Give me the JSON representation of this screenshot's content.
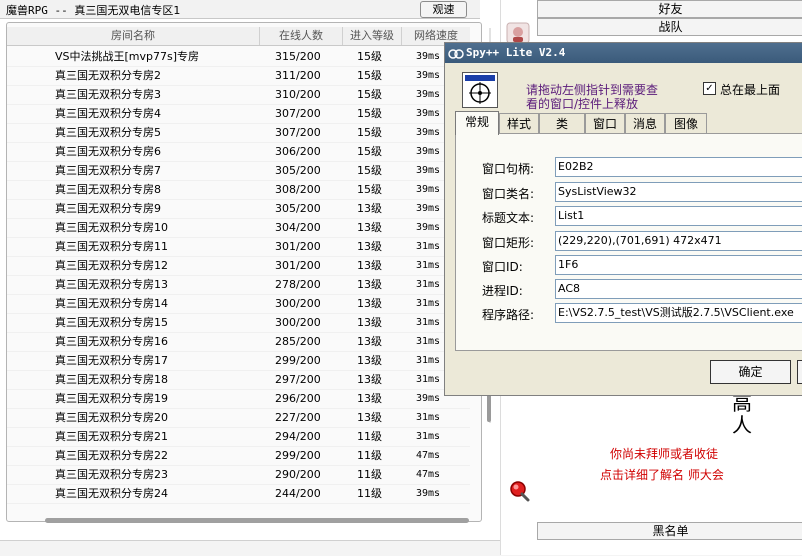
{
  "window": {
    "title_prefix": "魔兽RPG -- ",
    "title_main": "真三国无双电信专区1",
    "watch_button": "观速"
  },
  "room_list": {
    "columns": [
      "房间名称",
      "在线人数",
      "进入等级",
      "网络速度"
    ],
    "rows": [
      {
        "name": "VS中法挑战王[mvp77s]专房",
        "online": "315/200",
        "level": "15级",
        "speed": "39ms"
      },
      {
        "name": "真三国无双积分专房2",
        "online": "311/200",
        "level": "15级",
        "speed": "39ms"
      },
      {
        "name": "真三国无双积分专房3",
        "online": "310/200",
        "level": "15级",
        "speed": "39ms"
      },
      {
        "name": "真三国无双积分专房4",
        "online": "307/200",
        "level": "15级",
        "speed": "39ms"
      },
      {
        "name": "真三国无双积分专房5",
        "online": "307/200",
        "level": "15级",
        "speed": "39ms"
      },
      {
        "name": "真三国无双积分专房6",
        "online": "306/200",
        "level": "15级",
        "speed": "39ms"
      },
      {
        "name": "真三国无双积分专房7",
        "online": "305/200",
        "level": "15级",
        "speed": "39ms"
      },
      {
        "name": "真三国无双积分专房8",
        "online": "308/200",
        "level": "15级",
        "speed": "39ms"
      },
      {
        "name": "真三国无双积分专房9",
        "online": "305/200",
        "level": "13级",
        "speed": "39ms"
      },
      {
        "name": "真三国无双积分专房10",
        "online": "304/200",
        "level": "13级",
        "speed": "39ms"
      },
      {
        "name": "真三国无双积分专房11",
        "online": "301/200",
        "level": "13级",
        "speed": "31ms"
      },
      {
        "name": "真三国无双积分专房12",
        "online": "301/200",
        "level": "13级",
        "speed": "31ms"
      },
      {
        "name": "真三国无双积分专房13",
        "online": "278/200",
        "level": "13级",
        "speed": "31ms"
      },
      {
        "name": "真三国无双积分专房14",
        "online": "300/200",
        "level": "13级",
        "speed": "31ms"
      },
      {
        "name": "真三国无双积分专房15",
        "online": "300/200",
        "level": "13级",
        "speed": "31ms"
      },
      {
        "name": "真三国无双积分专房16",
        "online": "285/200",
        "level": "13级",
        "speed": "31ms"
      },
      {
        "name": "真三国无双积分专房17",
        "online": "299/200",
        "level": "13级",
        "speed": "31ms"
      },
      {
        "name": "真三国无双积分专房18",
        "online": "297/200",
        "level": "13级",
        "speed": "31ms"
      },
      {
        "name": "真三国无双积分专房19",
        "online": "296/200",
        "level": "13级",
        "speed": "39ms"
      },
      {
        "name": "真三国无双积分专房20",
        "online": "227/200",
        "level": "13级",
        "speed": "31ms"
      },
      {
        "name": "真三国无双积分专房21",
        "online": "294/200",
        "level": "11级",
        "speed": "31ms"
      },
      {
        "name": "真三国无双积分专房22",
        "online": "299/200",
        "level": "11级",
        "speed": "47ms"
      },
      {
        "name": "真三国无双积分专房23",
        "online": "290/200",
        "level": "11级",
        "speed": "47ms"
      },
      {
        "name": "真三国无双积分专房24",
        "online": "244/200",
        "level": "11级",
        "speed": "39ms"
      }
    ]
  },
  "right_panel": {
    "buttons": [
      "好友",
      "战队"
    ],
    "blacklist_button": "黑名单",
    "calligraphy": "高人",
    "master_text_1": "你尚未拜师或者收徒",
    "master_text_2": "点击详细了解名 师大会"
  },
  "spy": {
    "title": "Spy++ Lite V2.4",
    "hint_line1": "请拖动左侧指针到需要查",
    "hint_line2": "看的窗口/控件上释放",
    "topmost_label": "总在最上面",
    "topmost_checked": "✓",
    "tabs": [
      "常规",
      "样式",
      "类",
      "窗口",
      "消息",
      "图像"
    ],
    "fields": [
      {
        "label": "窗口句柄:",
        "value": "E02B2"
      },
      {
        "label": "窗口类名:",
        "value": "SysListView32"
      },
      {
        "label": "标题文本:",
        "value": "List1"
      },
      {
        "label": "窗口矩形:",
        "value": "(229,220),(701,691)  472x471"
      },
      {
        "label": "窗口ID:",
        "value": "1F6"
      },
      {
        "label": "进程ID:",
        "value": "AC8"
      },
      {
        "label": "程序路径:",
        "value": "E:\\VS2.7.5_test\\VS测试版2.7.5\\VSClient.exe"
      }
    ],
    "ok_button": "确定"
  },
  "colors": {
    "spy_title_bar": "#3f5f7f",
    "hint_text": "#5a1a7a",
    "master_text": "#d00000"
  }
}
